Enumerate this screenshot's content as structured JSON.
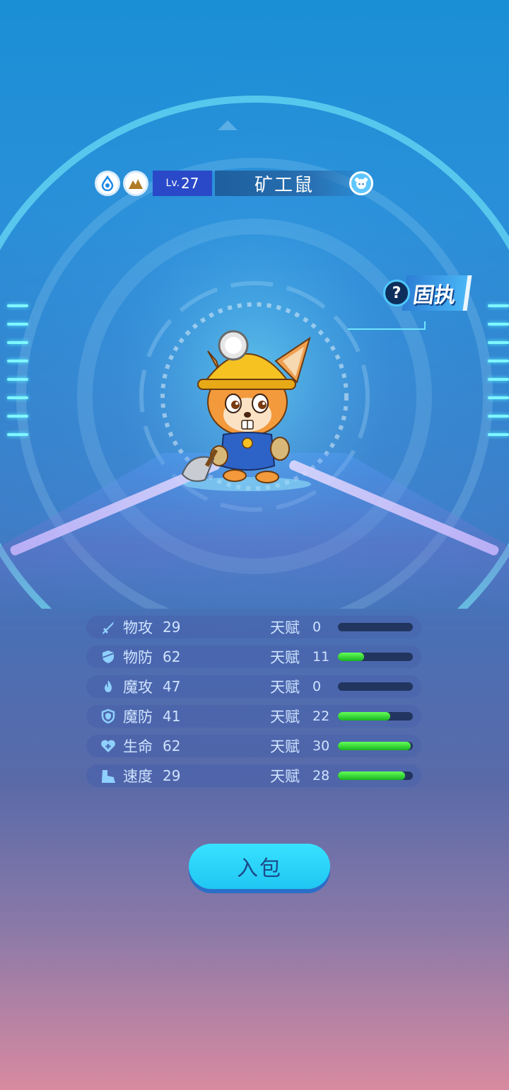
{
  "header": {
    "level_prefix": "Lv.",
    "level": "27",
    "pet_name": "矿工鼠",
    "element_icons": [
      "water-element-icon",
      "earth-element-icon"
    ]
  },
  "nature": {
    "help_symbol": "?",
    "label": "固执"
  },
  "stats": [
    {
      "name": "物攻",
      "value": "29",
      "talent_label": "天赋",
      "talent": "0",
      "talent_fraction": 0.0,
      "icon": "sword-icon"
    },
    {
      "name": "物防",
      "value": "62",
      "talent_label": "天赋",
      "talent": "11",
      "talent_fraction": 0.35,
      "icon": "shield-icon"
    },
    {
      "name": "魔攻",
      "value": "47",
      "talent_label": "天赋",
      "talent": "0",
      "talent_fraction": 0.0,
      "icon": "flame-icon"
    },
    {
      "name": "魔防",
      "value": "41",
      "talent_label": "天赋",
      "talent": "22",
      "talent_fraction": 0.7,
      "icon": "magic-shield-icon"
    },
    {
      "name": "生命",
      "value": "62",
      "talent_label": "天赋",
      "talent": "30",
      "talent_fraction": 0.97,
      "icon": "heart-icon"
    },
    {
      "name": "速度",
      "value": "29",
      "talent_label": "天赋",
      "talent": "28",
      "talent_fraction": 0.9,
      "icon": "boot-icon"
    }
  ],
  "actions": {
    "bag_button": "入包"
  },
  "colors": {
    "accent": "#37e2ff",
    "talent_fill": "#3fdc3a",
    "level_bg": "#2a49c9"
  }
}
